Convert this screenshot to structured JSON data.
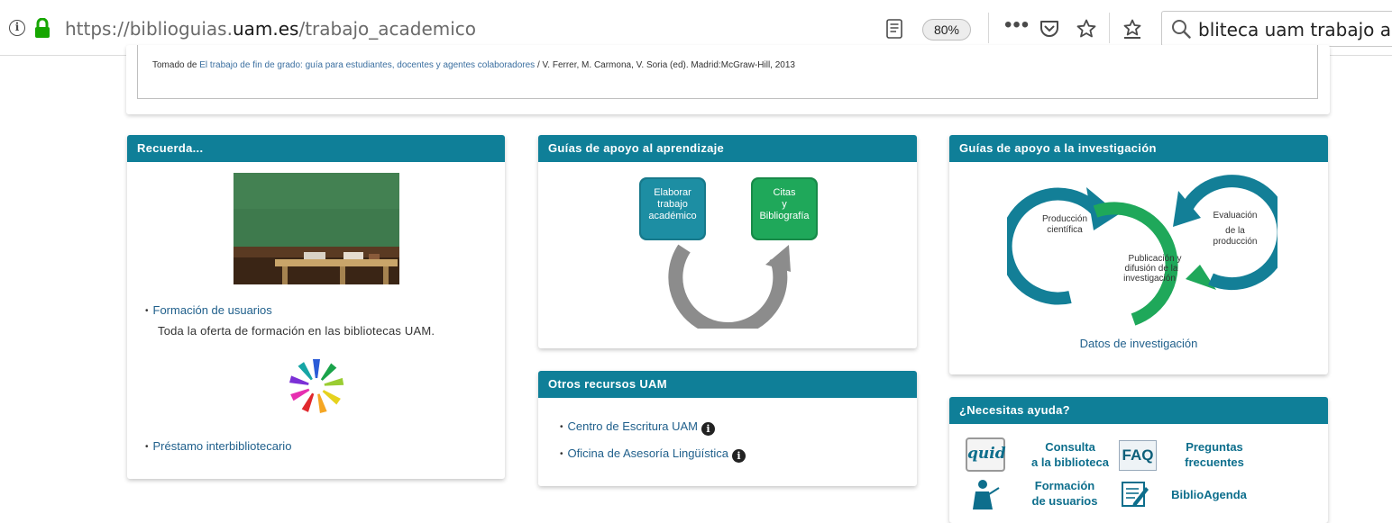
{
  "browser": {
    "url_prefix": "https://biblioguias.",
    "url_domain": "uam.es",
    "url_path": "/trabajo_academico",
    "zoom": "80%",
    "more_label": "•••",
    "search_text": "bliteca uam trabajo acad"
  },
  "top_card": {
    "source_prefix": "Tomado de ",
    "source_link": "El trabajo de fin de grado: guía para estudiantes, docentes y agentes colaboradores",
    "source_suffix": " / V. Ferrer, M. Carmona, V. Soria (ed). Madrid:McGraw-Hill, 2013"
  },
  "recuerda": {
    "title": "Recuerda...",
    "link1": "Formación de usuarios",
    "text1": "Toda la oferta de formación en las bibliotecas UAM.",
    "link2": "Préstamo interbibliotecario"
  },
  "aprendizaje": {
    "title": "Guías de apoyo al aprendizaje",
    "box1": [
      "Elaborar",
      "trabajo",
      "académico"
    ],
    "box2": [
      "Citas",
      "y",
      "Bibliografía"
    ],
    "colors": {
      "box1": "#1d8ea3",
      "box2": "#1fa85a",
      "arrow": "#8c8c8c"
    }
  },
  "otros": {
    "title": "Otros recursos UAM",
    "link1": "Centro de Escritura UAM",
    "link2": "Oficina de Asesoría Lingüística",
    "info_glyph": "i"
  },
  "investigacion": {
    "title": "Guías de apoyo a la investigación",
    "label1": [
      "Producción",
      "científica"
    ],
    "label2": [
      "Evaluación",
      "de la",
      "producción"
    ],
    "label3": [
      "Publicación y",
      "difusión de la",
      "investigación"
    ],
    "link": "Datos de investigación",
    "colors": {
      "cycle_blue": "#137f97",
      "cycle_green": "#1fa85a"
    }
  },
  "ayuda": {
    "title": "¿Necesitas ayuda?",
    "item1": [
      "Consulta",
      "a la biblioteca"
    ],
    "item2": [
      "Preguntas",
      "frecuentes"
    ],
    "item3": [
      "Formación",
      "de usuarios"
    ],
    "item4": "BiblioAgenda",
    "quid_icon": "quid",
    "faq_icon": "FAQ"
  },
  "colors": {
    "header": "#0f7f98",
    "link": "#1f5f8b"
  }
}
